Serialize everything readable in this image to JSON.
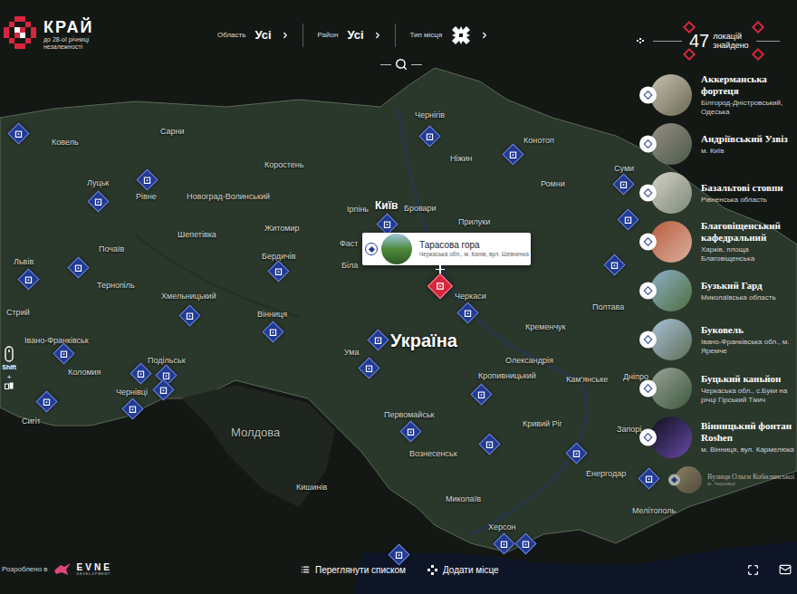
{
  "logo": {
    "title": "КРАЙ",
    "subtitle_lines": [
      "до 28-ої річниці",
      "незалежності"
    ]
  },
  "filters": [
    {
      "label": "Область",
      "kind": "value",
      "value": "Усі"
    },
    {
      "label": "Район",
      "kind": "value",
      "value": "Усі"
    },
    {
      "label": "Тип місця",
      "kind": "icon",
      "value": ""
    }
  ],
  "counter": {
    "value": "47",
    "label_lines": [
      "локацій",
      "знайдено"
    ]
  },
  "locations": [
    {
      "title": "Аккерманська фортеця",
      "subtitle": "Білгород-Дністровський, Одеська",
      "dimmed": false
    },
    {
      "title": "Андріївський Узвіз",
      "subtitle": "м. Київ",
      "dimmed": false
    },
    {
      "title": "Базальтові стовпи",
      "subtitle": "Рівненська область",
      "dimmed": false
    },
    {
      "title": "Благовіщенський кафедральний",
      "subtitle": "Харків, площа Благовіщенська",
      "dimmed": false
    },
    {
      "title": "Бузький Гард",
      "subtitle": "Миколаївська область",
      "dimmed": false
    },
    {
      "title": "Буковель",
      "subtitle": "Івано-Франківська обл., м. Яремче",
      "dimmed": false
    },
    {
      "title": "Буцький каньйон",
      "subtitle": "Черкаська обл., с.Буки на річці Гірський Тікич",
      "dimmed": false
    },
    {
      "title": "Вінницький фонтан Roshen",
      "subtitle": "м. Вінниця, вул. Кармелюка",
      "dimmed": false
    },
    {
      "title": "Вулиця Ольги Кобилянської",
      "subtitle": "м. Чернівці",
      "dimmed": true
    }
  ],
  "popup": {
    "title": "Тарасова гора",
    "subtitle": "Черкаська обл., м. Канів, вул. Шевченка"
  },
  "map": {
    "country": "Україна",
    "neighbour": "Молдова",
    "cities": [
      {
        "name": "Чернігів",
        "major": false
      },
      {
        "name": "Конотоп",
        "major": false
      },
      {
        "name": "Ніжин",
        "major": false
      },
      {
        "name": "Сарни",
        "major": false
      },
      {
        "name": "Ковель",
        "major": false
      },
      {
        "name": "Луцьк",
        "major": false
      },
      {
        "name": "Рівне",
        "major": false
      },
      {
        "name": "Новоград-Волинський",
        "major": false
      },
      {
        "name": "Коростень",
        "major": false
      },
      {
        "name": "Ірпінь",
        "major": false
      },
      {
        "name": "Київ",
        "major": true
      },
      {
        "name": "Бровари",
        "major": false
      },
      {
        "name": "Прилуки",
        "major": false
      },
      {
        "name": "Ромни",
        "major": false
      },
      {
        "name": "Суми",
        "major": false
      },
      {
        "name": "Житомир",
        "major": false
      },
      {
        "name": "Шепетівка",
        "major": false
      },
      {
        "name": "Почаїв",
        "major": false
      },
      {
        "name": "Фаст",
        "major": false
      },
      {
        "name": "Біла",
        "major": false
      },
      {
        "name": "Бердичів",
        "major": false
      },
      {
        "name": "Львів",
        "major": false
      },
      {
        "name": "Тернопіль",
        "major": false
      },
      {
        "name": "Хмельницький",
        "major": false
      },
      {
        "name": "Вінниця",
        "major": false
      },
      {
        "name": "Черкаси",
        "major": false
      },
      {
        "name": "Полтава",
        "major": false
      },
      {
        "name": "Кременчук",
        "major": false
      },
      {
        "name": "Ума",
        "major": false
      },
      {
        "name": "Стрий",
        "major": false
      },
      {
        "name": "Івано-Франківськ",
        "major": false
      },
      {
        "name": "Коломия",
        "major": false
      },
      {
        "name": "Чернівці",
        "major": false
      },
      {
        "name": "Подільськ",
        "major": false
      },
      {
        "name": "Олександрія",
        "major": false
      },
      {
        "name": "Кропивницький",
        "major": false
      },
      {
        "name": "Кам'янське",
        "major": false
      },
      {
        "name": "Дніпро",
        "major": false
      },
      {
        "name": "Первомайськ",
        "major": false
      },
      {
        "name": "Кривий Ріг",
        "major": false
      },
      {
        "name": "Вознесенськ",
        "major": false
      },
      {
        "name": "Запорі",
        "major": false
      },
      {
        "name": "Енергодар",
        "major": false
      },
      {
        "name": "Миколаїв",
        "major": false
      },
      {
        "name": "Херсон",
        "major": false
      },
      {
        "name": "Мелітополь",
        "major": false
      },
      {
        "name": "Кишинів",
        "major": false
      },
      {
        "name": "Сигіт",
        "major": false
      }
    ],
    "pins": [
      {
        "selected": false
      },
      {
        "selected": false
      },
      {
        "selected": false
      },
      {
        "selected": false
      },
      {
        "selected": false
      },
      {
        "selected": false
      },
      {
        "selected": false
      },
      {
        "selected": false
      },
      {
        "selected": false
      },
      {
        "selected": false
      },
      {
        "selected": false
      },
      {
        "selected": false
      },
      {
        "selected": false
      },
      {
        "selected": false
      },
      {
        "selected": false
      },
      {
        "selected": false
      },
      {
        "selected": false
      },
      {
        "selected": false
      },
      {
        "selected": false
      },
      {
        "selected": false
      },
      {
        "selected": false
      },
      {
        "selected": false
      },
      {
        "selected": false
      },
      {
        "selected": false
      },
      {
        "selected": false
      },
      {
        "selected": false
      },
      {
        "selected": false
      },
      {
        "selected": false
      },
      {
        "selected": false
      },
      {
        "selected": false
      },
      {
        "selected": false
      },
      {
        "selected": true
      }
    ]
  },
  "hint": {
    "key": "Shift",
    "plus": "+"
  },
  "footer": {
    "credit": "Розроблено в",
    "brand": "EVNE",
    "brand_sub": "DEVELOPMENT",
    "list_button": "Переглянути списком",
    "add_button": "Додати місце"
  }
}
